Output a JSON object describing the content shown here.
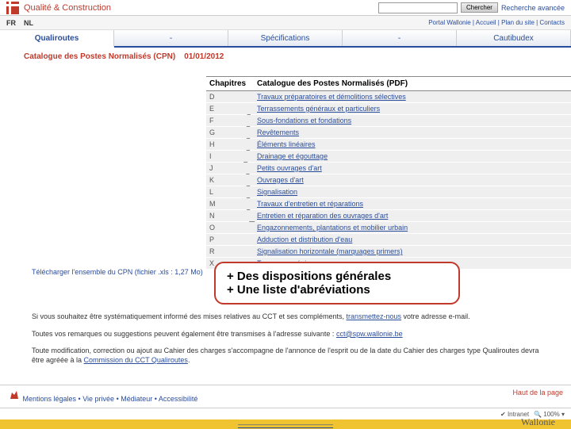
{
  "brand": "Qualité & Construction",
  "search": {
    "button": "Chercher",
    "advanced": "Recherche avancée",
    "placeholder": ""
  },
  "portal_links": "Portal Wallonie | Accueil | Plan du site | Contacts",
  "langs": [
    "FR",
    "NL"
  ],
  "tabs": [
    "Qualiroutes",
    "-",
    "Spécifications",
    "-",
    "Cautibudex"
  ],
  "breadcrumb": {
    "title": "Catalogue des Postes Normalisés (CPN)",
    "date": "01/01/2012"
  },
  "table_header": {
    "c1": "Chapitres",
    "c2": "Catalogue des Postes Normalisés (PDF)"
  },
  "chapters": [
    {
      "code": "D",
      "label": "Travaux préparatoires et démolitions sélectives"
    },
    {
      "code": "E",
      "label": "Terrassements généraux et particuliers"
    },
    {
      "code": "F",
      "label": "Sous-fondations et fondations"
    },
    {
      "code": "G",
      "label": "Revêtements"
    },
    {
      "code": "H",
      "label": "Éléments linéaires"
    },
    {
      "code": "I",
      "label": "Drainage et égouttage"
    },
    {
      "code": "J",
      "label": "Petits ouvrages d'art"
    },
    {
      "code": "K",
      "label": "Ouvrages d'art"
    },
    {
      "code": "L",
      "label": "Signalisation"
    },
    {
      "code": "M",
      "label": "Travaux d'entretien et réparations"
    },
    {
      "code": "N",
      "label": "Entretien et réparation des ouvrages d'art"
    },
    {
      "code": "O",
      "label": "Engazonnements, plantations et mobilier urbain"
    },
    {
      "code": "P",
      "label": "Adduction et distribution d'eau"
    },
    {
      "code": "R",
      "label": "Signalisation horizontale (marquages primers)"
    },
    {
      "code": "X",
      "label": "Travaux en régie"
    }
  ],
  "callout": {
    "line1": "+ Des dispositions générales",
    "line2": "+ Une liste d'abréviations"
  },
  "download": "Télécharger l'ensemble du CPN (fichier .xls : 1,27 Mo)",
  "paras": {
    "p1_a": "Si vous souhaitez être systématiquement informé des mises relatives au CCT et ses compléments, ",
    "p1_link": "transmettez-nous",
    "p1_b": " votre adresse e-mail.",
    "p2_a": "Toutes vos remarques ou suggestions peuvent également être transmises à l'adresse suivante : ",
    "p2_link": "cct@spw.wallonie.be",
    "p3_a": "Toute modification, correction ou ajout au Cahier des charges s'accompagne de l'annonce de l'esprit ou de la date du Cahier des charges type Qualiroutes devra être agréée à la ",
    "p3_link": "Commission du CCT Qualiroutes"
  },
  "footer": {
    "links": "Mentions légales • Vie privée • Médiateur • Accessibilité",
    "haut": "Haut de la page"
  },
  "status": {
    "intranet": "Intranet",
    "zoom": "100%"
  },
  "wallonie": "Wallonie"
}
